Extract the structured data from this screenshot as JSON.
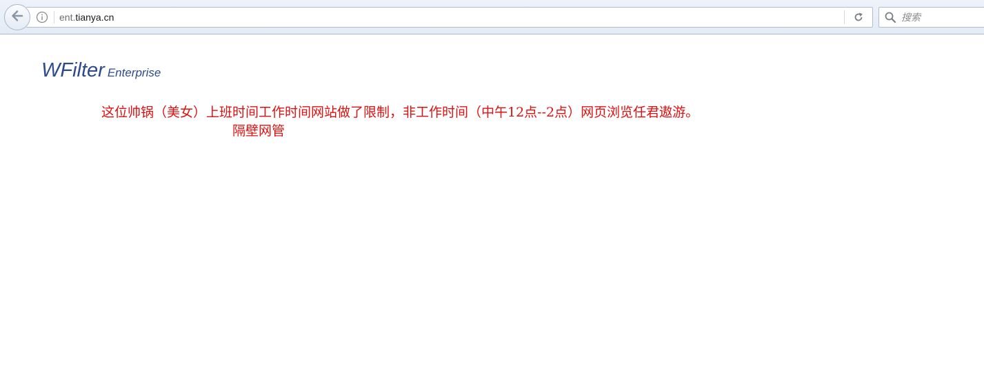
{
  "browser": {
    "url_prefix": "ent.",
    "url_host": "tianya.cn",
    "search_placeholder": "搜索"
  },
  "page": {
    "brand": {
      "name": "WFilter",
      "edition": "Enterprise",
      "color": "#2e4a8e"
    },
    "notice": "这位帅锅（美女）上班时间工作时间网站做了限制，非工作时间（中午12点--2点）网页浏览任君遨游。",
    "signature": "隔壁网管",
    "notice_color": "#e20f0f"
  }
}
